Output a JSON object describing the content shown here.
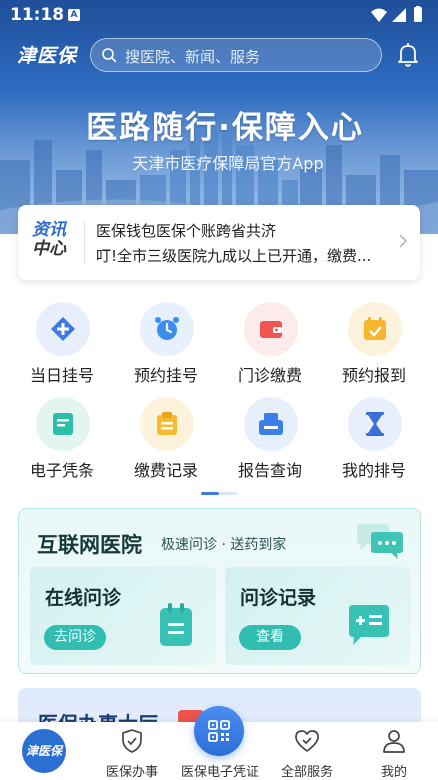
{
  "status_bar": {
    "time": "11:18",
    "notification_badge": "A"
  },
  "header": {
    "app_name": "津医保",
    "search_placeholder": "搜医院、新闻、服务"
  },
  "banner": {
    "slogan": "医路随行·保障入心",
    "subtitle": "天津市医疗保障局官方App"
  },
  "news": {
    "badge_line1": "资讯",
    "badge_line2": "中心",
    "items": [
      "医保钱包医保个账跨省共济",
      "叮!全市三级医院九成以上已开通，缴费..."
    ]
  },
  "services": [
    {
      "label": "当日挂号",
      "icon": "diamond-cross-icon",
      "bg": "#e8eefc",
      "color": "#3c7ae6"
    },
    {
      "label": "预约挂号",
      "icon": "alarm-clock-icon",
      "bg": "#e6f1fd",
      "color": "#3b8ef0"
    },
    {
      "label": "门诊缴费",
      "icon": "wallet-icon",
      "bg": "#fdeaea",
      "color": "#f2554f"
    },
    {
      "label": "预约报到",
      "icon": "calendar-check-icon",
      "bg": "#fdf2dc",
      "color": "#f5b52c"
    },
    {
      "label": "电子凭条",
      "icon": "receipt-icon",
      "bg": "#e2f5f1",
      "color": "#2bbfa8"
    },
    {
      "label": "缴费记录",
      "icon": "clipboard-icon",
      "bg": "#fdf3dd",
      "color": "#f7bb2e"
    },
    {
      "label": "报告查询",
      "icon": "printer-icon",
      "bg": "#e6f0fd",
      "color": "#3b7fe8"
    },
    {
      "label": "我的排号",
      "icon": "hourglass-icon",
      "bg": "#e8eefc",
      "color": "#3a6fd8"
    }
  ],
  "internet_hospital": {
    "title": "互联网医院",
    "subtitle": "极速问诊 · 送药到家",
    "consult": {
      "title": "在线问诊",
      "button": "去问诊"
    },
    "records": {
      "title": "问诊记录",
      "button": "查看"
    }
  },
  "service_hall": {
    "title": "医保办事大厅"
  },
  "bottom_nav": {
    "home_logo": "津医保",
    "items": [
      "医保办事",
      "医保电子凭证",
      "全部服务",
      "我的"
    ]
  },
  "colors": {
    "primary": "#2c6fd3",
    "teal": "#31bdb2"
  }
}
